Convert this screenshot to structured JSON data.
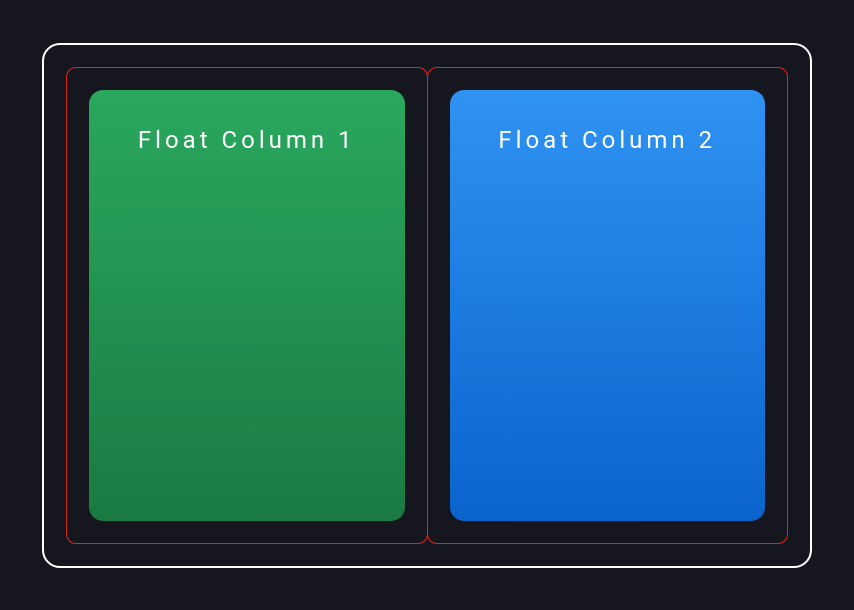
{
  "columns": [
    {
      "label": "Float Column 1"
    },
    {
      "label": "Float Column 2"
    }
  ]
}
